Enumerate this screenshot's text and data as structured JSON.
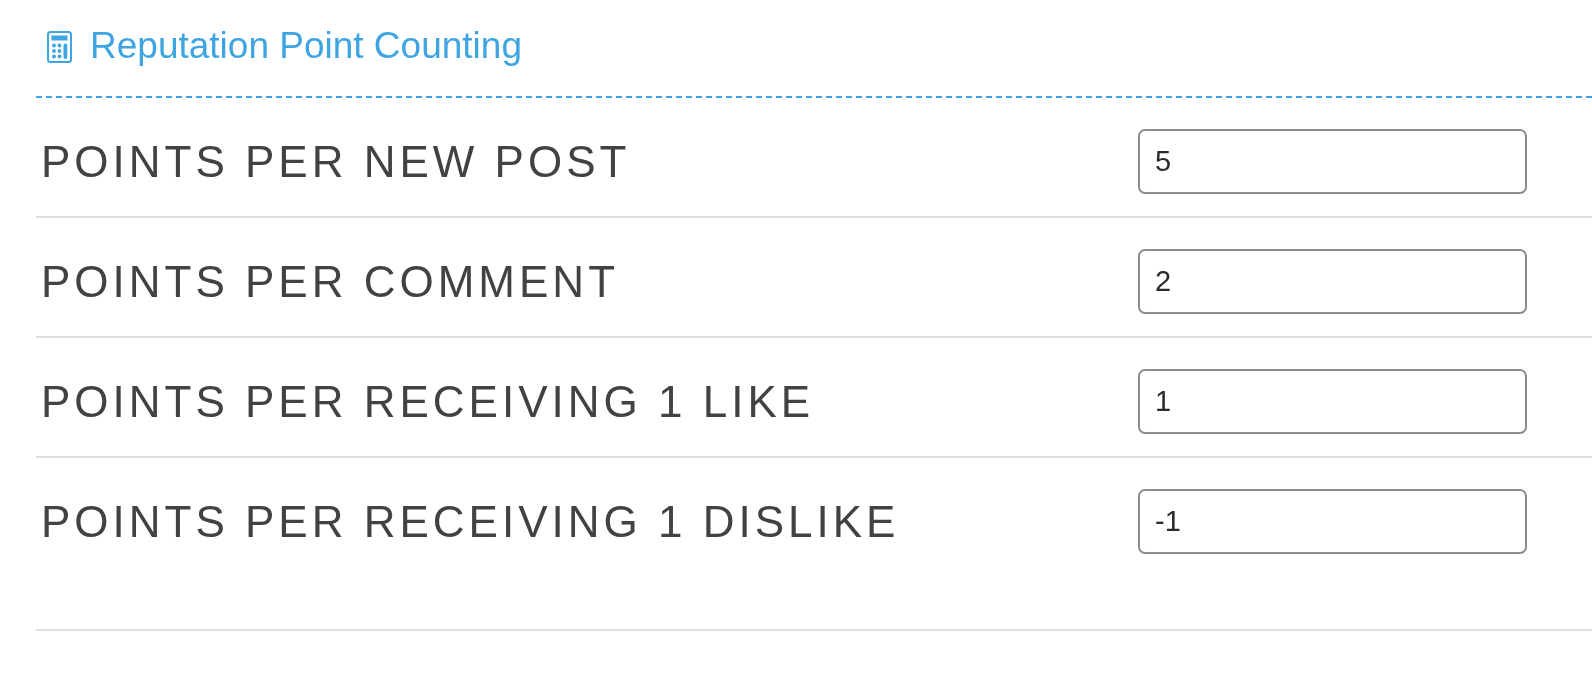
{
  "section": {
    "title": "Reputation Point Counting"
  },
  "settings": [
    {
      "label": "POINTS PER NEW POST",
      "value": "5"
    },
    {
      "label": "POINTS PER COMMENT",
      "value": "2"
    },
    {
      "label": "POINTS PER RECEIVING 1 LIKE",
      "value": "1"
    },
    {
      "label": "POINTS PER RECEIVING 1 DISLIKE",
      "value": "-1"
    }
  ]
}
